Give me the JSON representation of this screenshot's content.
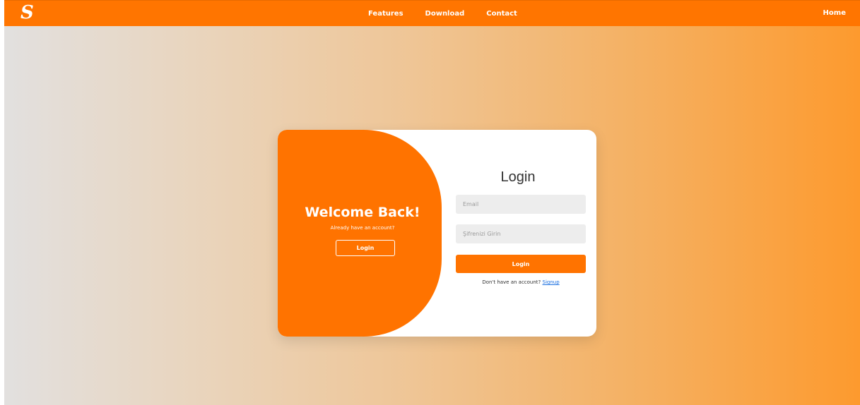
{
  "navbar": {
    "logo": "S",
    "links": [
      "Features",
      "Download",
      "Contact"
    ],
    "home": "Home"
  },
  "welcome": {
    "title": "Welcome Back!",
    "subtitle": "Already have an account?",
    "button_label": "Login"
  },
  "login_form": {
    "title": "Login",
    "email_placeholder": "Email",
    "password_placeholder": "Şifrenizi Girin",
    "submit_label": "Login",
    "signup_prompt": "Don't have an account?",
    "signup_link": "Signup"
  },
  "colors": {
    "accent": "#ff7300",
    "link": "#1a6fe0"
  }
}
